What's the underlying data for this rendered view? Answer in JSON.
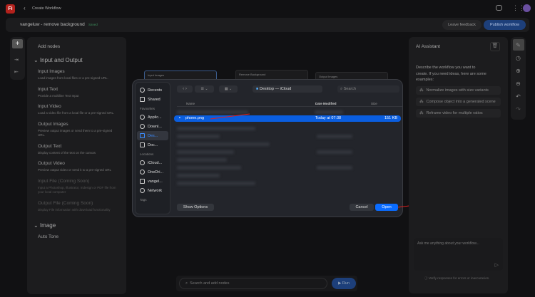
{
  "app": {
    "logo": "Fi",
    "back": "‹",
    "title": "Create Workflow"
  },
  "subbar": {
    "workflow_name": "vangeluw - remove background",
    "status": "Saved",
    "leave_feedback": "Leave feedback",
    "publish": "Publish workflow"
  },
  "add_nodes": {
    "title": "Add nodes",
    "sections": [
      {
        "label": "Input and Output",
        "items": [
          {
            "title": "Input Images",
            "desc": "Load images from local files or a pre-signed URL."
          },
          {
            "title": "Input Text",
            "desc": "Provide a multiline Text Input"
          },
          {
            "title": "Input Video",
            "desc": "Load a video file from a local file or a pre-signed URL."
          },
          {
            "title": "Output Images",
            "desc": "Preview output images or send them to a pre-signed URL."
          },
          {
            "title": "Output Text",
            "desc": "Display content of the text on the canvas"
          },
          {
            "title": "Output Video",
            "desc": "Preview output video or send it to a pre-signed URL"
          },
          {
            "title": "Input File (Coming Soon)",
            "desc": "Input a Photoshop, Illustrator, Indesign or PDF file from your local computer"
          },
          {
            "title": "Output File (Coming Soon)",
            "desc": "Display File information with download functionality"
          }
        ]
      },
      {
        "label": "Image",
        "items": [
          {
            "title": "Auto Tone"
          }
        ]
      }
    ]
  },
  "canvas": {
    "nodes": [
      "Input Images",
      "Remove Background",
      "Output Images"
    ]
  },
  "dialog": {
    "sidebar": {
      "items1": [
        "Recents",
        "Shared"
      ],
      "fav_header": "Favourites",
      "favourites": [
        "Applic...",
        "Downl...",
        "Des...",
        "Doc..."
      ],
      "loc_header": "Locations",
      "locations": [
        "iCloud...",
        "OneDri...",
        "vangel...",
        "Network"
      ],
      "tags_header": "Tags"
    },
    "location": "Desktop — iCloud",
    "search_placeholder": "Search",
    "columns": {
      "name": "Name",
      "date": "Date Modified",
      "size": "Size"
    },
    "selected_file": {
      "name": "phone.png",
      "date": "Today at 07:38",
      "size": "151 KB"
    },
    "show_options": "Show Options",
    "cancel": "Cancel",
    "open": "Open"
  },
  "assistant": {
    "title": "AI Assistant",
    "intro": "Describe the workflow you want to create. If you need ideas, here are some examples:",
    "examples": [
      "Normalize images with size variants",
      "Compose object into a generated scene",
      "Reframe video for multiple ratios"
    ],
    "input_placeholder": "Ask me anything about your workflow...",
    "disclaimer": "Verify responses for errors or inaccuracies."
  },
  "bottom": {
    "search_placeholder": "Search and add nodes",
    "run": "Run"
  },
  "colors": {
    "accent": "#0a6cff",
    "publish": "#1d3f7a",
    "annotation": "#e02020"
  }
}
